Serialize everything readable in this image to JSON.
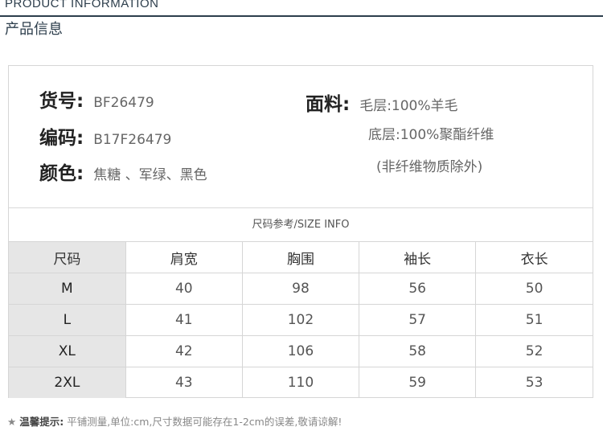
{
  "header": {
    "en_title": "PRODUCT INFORMATION",
    "cn_title": "产品信息"
  },
  "info": {
    "item_no": {
      "label": "货号:",
      "value": "BF26479"
    },
    "code": {
      "label": "编码:",
      "value": "B17F26479"
    },
    "color": {
      "label": "颜色:",
      "value": "焦糖 、军绿、黑色"
    },
    "fabric": {
      "label": "面料:",
      "line1": "毛层:100%羊毛",
      "line2": "底层:100%聚酯纤维",
      "line3": "(非纤维物质除外)"
    }
  },
  "size_table": {
    "caption": "尺码参考/SIZE INFO",
    "headers": [
      "尺码",
      "肩宽",
      "胸围",
      "袖长",
      "衣长"
    ],
    "rows": [
      [
        "M",
        "40",
        "98",
        "56",
        "50"
      ],
      [
        "L",
        "41",
        "102",
        "57",
        "51"
      ],
      [
        "XL",
        "42",
        "106",
        "58",
        "52"
      ],
      [
        "2XL",
        "43",
        "110",
        "59",
        "53"
      ]
    ]
  },
  "tip": {
    "star": "★",
    "label": "温馨提示:",
    "text": "平铺测量,单位:cm,尺寸数据可能存在1-2cm的误差,敬请谅解!"
  }
}
